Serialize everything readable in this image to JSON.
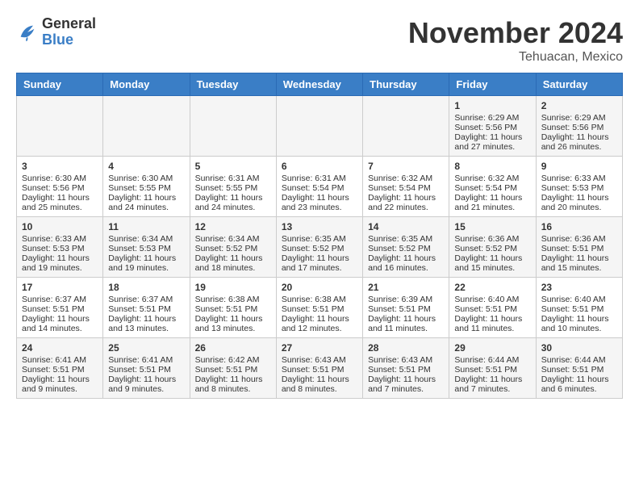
{
  "header": {
    "logo": {
      "general": "General",
      "blue": "Blue"
    },
    "title": "November 2024",
    "location": "Tehuacan, Mexico"
  },
  "columns": [
    "Sunday",
    "Monday",
    "Tuesday",
    "Wednesday",
    "Thursday",
    "Friday",
    "Saturday"
  ],
  "weeks": [
    [
      {
        "day": "",
        "info": ""
      },
      {
        "day": "",
        "info": ""
      },
      {
        "day": "",
        "info": ""
      },
      {
        "day": "",
        "info": ""
      },
      {
        "day": "",
        "info": ""
      },
      {
        "day": "1",
        "info": "Sunrise: 6:29 AM\nSunset: 5:56 PM\nDaylight: 11 hours and 27 minutes."
      },
      {
        "day": "2",
        "info": "Sunrise: 6:29 AM\nSunset: 5:56 PM\nDaylight: 11 hours and 26 minutes."
      }
    ],
    [
      {
        "day": "3",
        "info": "Sunrise: 6:30 AM\nSunset: 5:56 PM\nDaylight: 11 hours and 25 minutes."
      },
      {
        "day": "4",
        "info": "Sunrise: 6:30 AM\nSunset: 5:55 PM\nDaylight: 11 hours and 24 minutes."
      },
      {
        "day": "5",
        "info": "Sunrise: 6:31 AM\nSunset: 5:55 PM\nDaylight: 11 hours and 24 minutes."
      },
      {
        "day": "6",
        "info": "Sunrise: 6:31 AM\nSunset: 5:54 PM\nDaylight: 11 hours and 23 minutes."
      },
      {
        "day": "7",
        "info": "Sunrise: 6:32 AM\nSunset: 5:54 PM\nDaylight: 11 hours and 22 minutes."
      },
      {
        "day": "8",
        "info": "Sunrise: 6:32 AM\nSunset: 5:54 PM\nDaylight: 11 hours and 21 minutes."
      },
      {
        "day": "9",
        "info": "Sunrise: 6:33 AM\nSunset: 5:53 PM\nDaylight: 11 hours and 20 minutes."
      }
    ],
    [
      {
        "day": "10",
        "info": "Sunrise: 6:33 AM\nSunset: 5:53 PM\nDaylight: 11 hours and 19 minutes."
      },
      {
        "day": "11",
        "info": "Sunrise: 6:34 AM\nSunset: 5:53 PM\nDaylight: 11 hours and 19 minutes."
      },
      {
        "day": "12",
        "info": "Sunrise: 6:34 AM\nSunset: 5:52 PM\nDaylight: 11 hours and 18 minutes."
      },
      {
        "day": "13",
        "info": "Sunrise: 6:35 AM\nSunset: 5:52 PM\nDaylight: 11 hours and 17 minutes."
      },
      {
        "day": "14",
        "info": "Sunrise: 6:35 AM\nSunset: 5:52 PM\nDaylight: 11 hours and 16 minutes."
      },
      {
        "day": "15",
        "info": "Sunrise: 6:36 AM\nSunset: 5:52 PM\nDaylight: 11 hours and 15 minutes."
      },
      {
        "day": "16",
        "info": "Sunrise: 6:36 AM\nSunset: 5:51 PM\nDaylight: 11 hours and 15 minutes."
      }
    ],
    [
      {
        "day": "17",
        "info": "Sunrise: 6:37 AM\nSunset: 5:51 PM\nDaylight: 11 hours and 14 minutes."
      },
      {
        "day": "18",
        "info": "Sunrise: 6:37 AM\nSunset: 5:51 PM\nDaylight: 11 hours and 13 minutes."
      },
      {
        "day": "19",
        "info": "Sunrise: 6:38 AM\nSunset: 5:51 PM\nDaylight: 11 hours and 13 minutes."
      },
      {
        "day": "20",
        "info": "Sunrise: 6:38 AM\nSunset: 5:51 PM\nDaylight: 11 hours and 12 minutes."
      },
      {
        "day": "21",
        "info": "Sunrise: 6:39 AM\nSunset: 5:51 PM\nDaylight: 11 hours and 11 minutes."
      },
      {
        "day": "22",
        "info": "Sunrise: 6:40 AM\nSunset: 5:51 PM\nDaylight: 11 hours and 11 minutes."
      },
      {
        "day": "23",
        "info": "Sunrise: 6:40 AM\nSunset: 5:51 PM\nDaylight: 11 hours and 10 minutes."
      }
    ],
    [
      {
        "day": "24",
        "info": "Sunrise: 6:41 AM\nSunset: 5:51 PM\nDaylight: 11 hours and 9 minutes."
      },
      {
        "day": "25",
        "info": "Sunrise: 6:41 AM\nSunset: 5:51 PM\nDaylight: 11 hours and 9 minutes."
      },
      {
        "day": "26",
        "info": "Sunrise: 6:42 AM\nSunset: 5:51 PM\nDaylight: 11 hours and 8 minutes."
      },
      {
        "day": "27",
        "info": "Sunrise: 6:43 AM\nSunset: 5:51 PM\nDaylight: 11 hours and 8 minutes."
      },
      {
        "day": "28",
        "info": "Sunrise: 6:43 AM\nSunset: 5:51 PM\nDaylight: 11 hours and 7 minutes."
      },
      {
        "day": "29",
        "info": "Sunrise: 6:44 AM\nSunset: 5:51 PM\nDaylight: 11 hours and 7 minutes."
      },
      {
        "day": "30",
        "info": "Sunrise: 6:44 AM\nSunset: 5:51 PM\nDaylight: 11 hours and 6 minutes."
      }
    ]
  ]
}
